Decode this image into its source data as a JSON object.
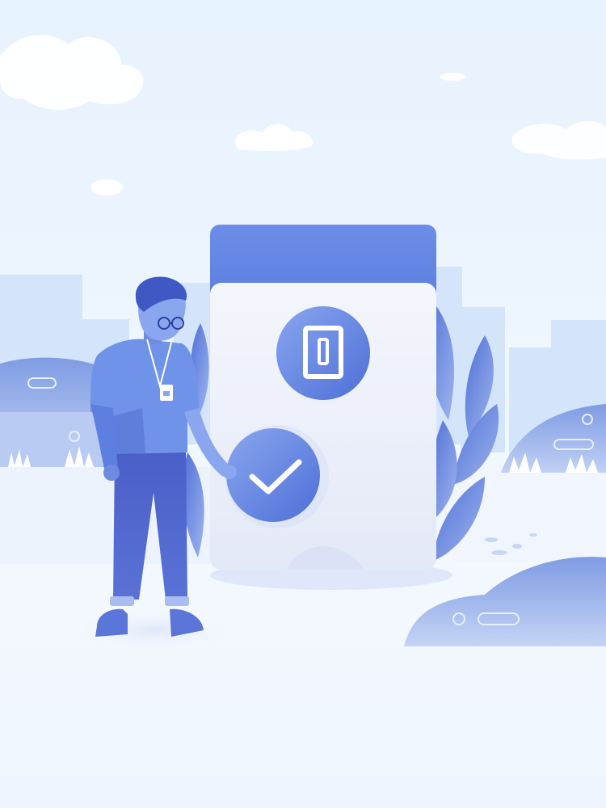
{
  "illustration": {
    "theme": "verification-approved",
    "colors": {
      "sky": "#e6f2fd",
      "primary": "#5a7fe0",
      "primary_dark": "#3f5dc8",
      "card_header": "#6588e6",
      "card_body": "#eef2fb",
      "hill": "#8ea8e6",
      "building": "#d5e6fb",
      "pants": "#4b5fc6",
      "shirt": "#6f93e8"
    },
    "icons": [
      "switch-icon",
      "checkmark-icon",
      "id-badge-icon",
      "glasses-icon"
    ]
  }
}
